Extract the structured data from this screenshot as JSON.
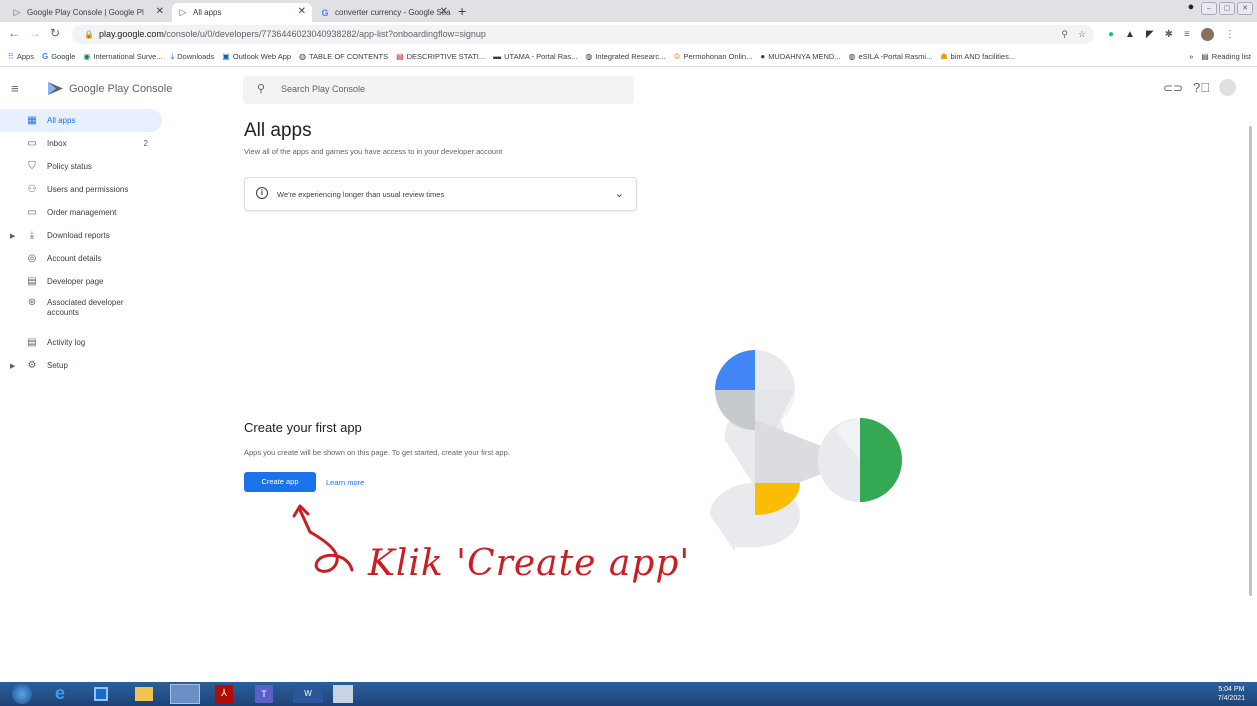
{
  "browser": {
    "tabs": [
      {
        "label": "Google Play Console | Google Pl",
        "active": false
      },
      {
        "label": "All apps",
        "active": true
      },
      {
        "label": "converter currency - Google Sea",
        "active": false
      }
    ],
    "url_host": "play.google.com",
    "url_path": "/console/u/0/developers/7736446023040938282/app-list?onboardingflow=signup",
    "bookmarks": [
      "Apps",
      "Google",
      "International Surve...",
      "Downloads",
      "Outlook Web App",
      "TABLE OF CONTENTS",
      "DESCRIPTIVE STATI...",
      "UTAMA - Portal Ras...",
      "Integrated Researc...",
      "Permohonan Onlin...",
      "MUDAHNYA MEND...",
      "eSILA -Portal Rasmi...",
      "bim AND facilities..."
    ],
    "reading_list": "Reading list"
  },
  "header": {
    "logo_google_play": "Google Play",
    "logo_console": "Console",
    "search_placeholder": "Search Play Console"
  },
  "sidebar": {
    "items": [
      {
        "label": "All apps",
        "icon": "grid-icon",
        "selected": true
      },
      {
        "label": "Inbox",
        "icon": "inbox-icon",
        "count": "2"
      },
      {
        "label": "Policy status",
        "icon": "shield-icon"
      },
      {
        "label": "Users and permissions",
        "icon": "users-icon"
      },
      {
        "label": "Order management",
        "icon": "card-icon"
      },
      {
        "label": "Download reports",
        "icon": "download-icon",
        "expandable": true
      },
      {
        "label": "Account details",
        "icon": "account-icon"
      },
      {
        "label": "Developer page",
        "icon": "page-icon"
      },
      {
        "label": "Associated developer accounts",
        "icon": "link-accounts-icon"
      },
      {
        "label": "Activity log",
        "icon": "document-icon"
      },
      {
        "label": "Setup",
        "icon": "gear-icon",
        "expandable": true
      }
    ]
  },
  "main": {
    "title": "All apps",
    "subtitle": "View all of the apps and games you have access to in your developer account",
    "notice": "We're experiencing longer than usual review times",
    "cfa_title": "Create your first app",
    "cfa_subtitle": "Apps you create will be shown on this page. To get started, create your first app.",
    "create_button": "Create app",
    "learn_more": "Learn more"
  },
  "annotation": "Klik 'Create app'",
  "taskbar": {
    "time": "5:04 PM",
    "date": "7/4/2021"
  },
  "colors": {
    "accent": "#1a73e8",
    "annotation": "#c81e24"
  }
}
